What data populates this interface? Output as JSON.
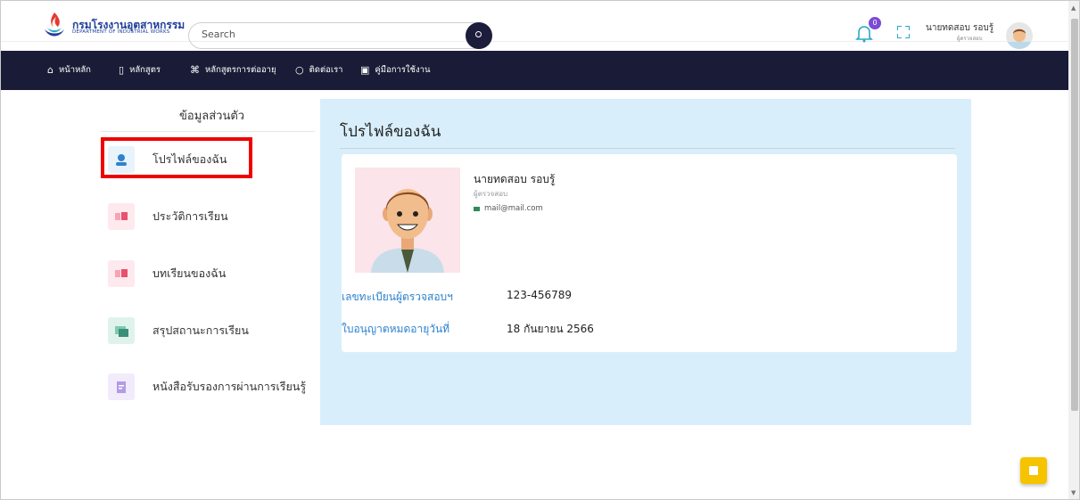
{
  "header": {
    "logo_th": "กรมโรงงานอุตสาหกรรม",
    "logo_en": "DEPARTMENT OF INDUSTRIAL WORKS",
    "search_placeholder": "Search",
    "notification_count": "0",
    "user_name": "นายทดสอบ รอบรู้",
    "user_role": "ผู้ตรวจสอบ"
  },
  "nav": {
    "items": [
      {
        "label": "หน้าหลัก",
        "icon": "home-icon"
      },
      {
        "label": "หลักสูตร",
        "icon": "book-icon"
      },
      {
        "label": "หลักสูตรการต่ออายุ",
        "icon": "command-icon"
      },
      {
        "label": "ติดต่อเรา",
        "icon": "chat-icon"
      },
      {
        "label": "คู่มือการใช้งาน",
        "icon": "manual-icon"
      }
    ]
  },
  "sidebar": {
    "title": "ข้อมูลส่วนตัว",
    "items": [
      {
        "label": "โปรไฟล์ของฉัน",
        "icon": "user-icon",
        "color": "#e8f3fb"
      },
      {
        "label": "ประวัติการเรียน",
        "icon": "book-open-icon",
        "color": "#fde9ee"
      },
      {
        "label": "บทเรียนของฉัน",
        "icon": "book-open-icon",
        "color": "#fde9ee"
      },
      {
        "label": "สรุปสถานะการเรียน",
        "icon": "summary-icon",
        "color": "#dff3ec"
      },
      {
        "label": "หนังสือรับรองการผ่านการเรียนรู้",
        "icon": "certificate-icon",
        "color": "#f1ebfb"
      }
    ]
  },
  "profile": {
    "title": "โปรไฟล์ของฉัน",
    "name": "นายทดสอบ รอบรู้",
    "role": "ผู้ตรวจสอบ",
    "email": "mail@mail.com",
    "fields": [
      {
        "label": "เลขทะเบียนผู้ตรวจสอบฯ",
        "value": "123-456789"
      },
      {
        "label": "ใบอนุญาตหมดอายุวันที่",
        "value": "18 กันยายน 2566"
      }
    ]
  },
  "colors": {
    "nav_bg": "#1a1c37",
    "panel_bg": "#d8effb",
    "label_blue": "#2d82cc",
    "highlight_red": "#ee0000",
    "fab_yellow": "#f6c300"
  }
}
